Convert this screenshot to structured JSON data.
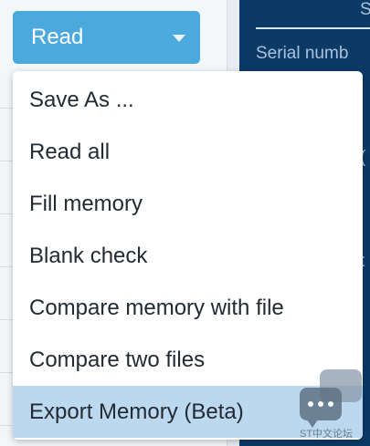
{
  "read_button": {
    "label": "Read"
  },
  "right_panel": {
    "serial_label": "Serial numb",
    "top_edge_char": "S",
    "mid_char_1": "(",
    "mid_char_2": "t"
  },
  "menu": {
    "items": [
      {
        "label": "Save As ..."
      },
      {
        "label": "Read all"
      },
      {
        "label": "Fill memory"
      },
      {
        "label": "Blank check"
      },
      {
        "label": "Compare memory with file"
      },
      {
        "label": "Compare two files"
      },
      {
        "label": "Export Memory (Beta)",
        "highlighted": true
      }
    ]
  },
  "chat_widget": {
    "caption": "ST中文论坛"
  },
  "colors": {
    "button_blue": "#4ca9de",
    "highlight": "#bcd8ef",
    "dark_panel": "#0b3a67"
  }
}
